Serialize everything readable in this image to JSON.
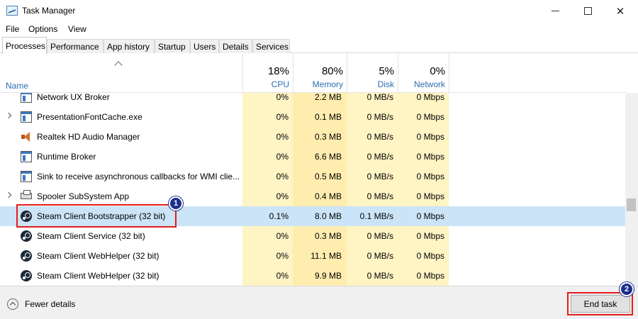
{
  "window": {
    "title": "Task Manager",
    "min_icon": "minimize-icon",
    "max_icon": "maximize-icon",
    "close_icon": "close-icon"
  },
  "menu": [
    "File",
    "Options",
    "View"
  ],
  "tabs": [
    "Processes",
    "Performance",
    "App history",
    "Startup",
    "Users",
    "Details",
    "Services"
  ],
  "active_tab": "Processes",
  "columns": {
    "name": "Name",
    "cpu": {
      "pct": "18%",
      "label": "CPU"
    },
    "memory": {
      "pct": "80%",
      "label": "Memory"
    },
    "disk": {
      "pct": "5%",
      "label": "Disk"
    },
    "network": {
      "pct": "0%",
      "label": "Network"
    }
  },
  "rows": [
    {
      "name": "Network UX Broker",
      "cpu": "0%",
      "mem": "2.2 MB",
      "disk": "0 MB/s",
      "net": "0 Mbps",
      "icon": "window-icon"
    },
    {
      "name": "PresentationFontCache.exe",
      "cpu": "0%",
      "mem": "0.1 MB",
      "disk": "0 MB/s",
      "net": "0 Mbps",
      "icon": "window-icon"
    },
    {
      "name": "Realtek HD Audio Manager",
      "cpu": "0%",
      "mem": "0.3 MB",
      "disk": "0 MB/s",
      "net": "0 Mbps",
      "icon": "speaker-icon"
    },
    {
      "name": "Runtime Broker",
      "cpu": "0%",
      "mem": "6.6 MB",
      "disk": "0 MB/s",
      "net": "0 Mbps",
      "icon": "window-icon"
    },
    {
      "name": "Sink to receive asynchronous callbacks for WMI clie...",
      "cpu": "0%",
      "mem": "0.5 MB",
      "disk": "0 MB/s",
      "net": "0 Mbps",
      "icon": "window-icon"
    },
    {
      "name": "Spooler SubSystem App",
      "cpu": "0%",
      "mem": "0.4 MB",
      "disk": "0 MB/s",
      "net": "0 Mbps",
      "icon": "printer-icon"
    },
    {
      "name": "Steam Client Bootstrapper (32 bit)",
      "cpu": "0.1%",
      "mem": "8.0 MB",
      "disk": "0.1 MB/s",
      "net": "0 Mbps",
      "icon": "steam-icon"
    },
    {
      "name": "Steam Client Service (32 bit)",
      "cpu": "0%",
      "mem": "0.3 MB",
      "disk": "0 MB/s",
      "net": "0 Mbps",
      "icon": "steam-icon"
    },
    {
      "name": "Steam Client WebHelper (32 bit)",
      "cpu": "0%",
      "mem": "11.1 MB",
      "disk": "0 MB/s",
      "net": "0 Mbps",
      "icon": "steam-icon"
    },
    {
      "name": "Steam Client WebHelper (32 bit)",
      "cpu": "0%",
      "mem": "9.9 MB",
      "disk": "0 MB/s",
      "net": "0 Mbps",
      "icon": "steam-icon"
    }
  ],
  "footer": {
    "fewer_details": "Fewer details",
    "end_task": "End task"
  },
  "annotations": {
    "step1": "1",
    "step2": "2"
  },
  "colors": {
    "selected_row": "#cce4f7",
    "heat_light": "#fff4c4",
    "heat_mem": "#ffedaf",
    "highlight": "#e21d1d",
    "badge": "#1c2f8c"
  }
}
